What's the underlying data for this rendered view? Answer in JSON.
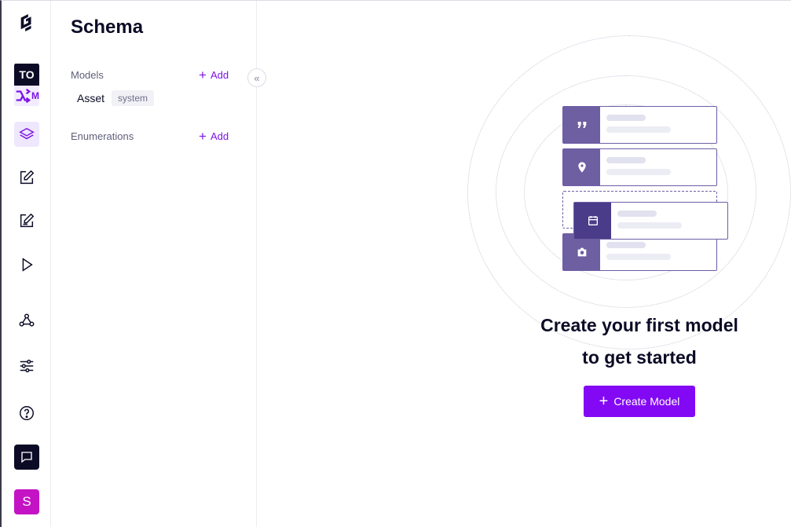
{
  "sidebar": {
    "project": {
      "initials": "TO",
      "env_icon": "branch-icon",
      "env_label": "M"
    },
    "items": [
      {
        "name": "schema",
        "icon": "layers-icon"
      },
      {
        "name": "content",
        "icon": "edit-icon"
      },
      {
        "name": "assets",
        "icon": "edit-icon"
      },
      {
        "name": "playground",
        "icon": "play-icon"
      },
      {
        "name": "webhooks",
        "icon": "webhook-icon"
      },
      {
        "name": "settings",
        "icon": "sliders-icon"
      },
      {
        "name": "help",
        "icon": "question-icon"
      },
      {
        "name": "feedback",
        "icon": "chat-icon"
      }
    ],
    "avatar_initial": "S"
  },
  "panel": {
    "title": "Schema",
    "models_label": "Models",
    "models_add": "Add",
    "models": [
      {
        "name": "Asset",
        "badge": "system"
      }
    ],
    "enumerations_label": "Enumerations",
    "enumerations_add": "Add"
  },
  "main": {
    "heading_line1": "Create your first model",
    "heading_line2": "to get started",
    "cta_label": "Create Model"
  },
  "colors": {
    "accent": "#8309f5",
    "card_icon": "#6d5fa2",
    "text": "#0b0b26"
  }
}
